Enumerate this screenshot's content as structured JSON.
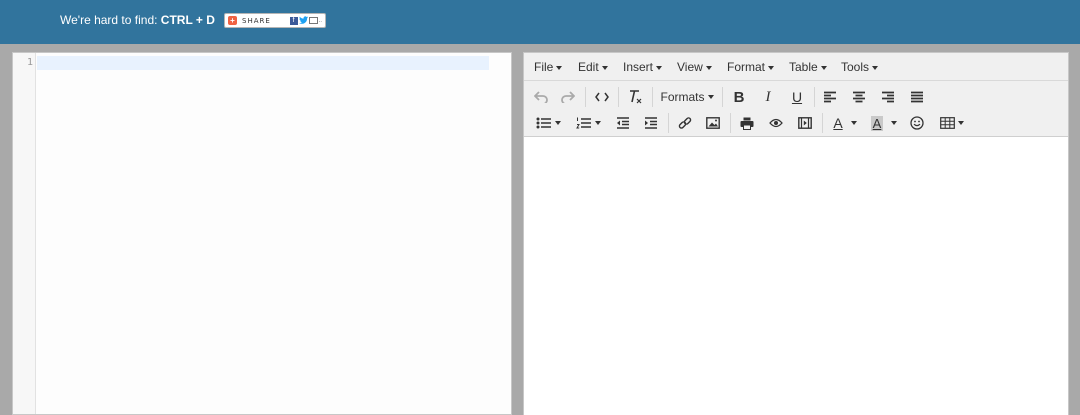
{
  "header": {
    "hint_text": "We're hard to find:",
    "hint_keys": "CTRL + D",
    "share_label": "SHARE",
    "share_plus": "+",
    "share_fb": "f",
    "share_tw": "✓",
    "share_more": ".."
  },
  "code_editor": {
    "line_numbers": [
      "1"
    ],
    "content": ""
  },
  "menubar": {
    "items": [
      "File",
      "Edit",
      "Insert",
      "View",
      "Format",
      "Table",
      "Tools"
    ]
  },
  "toolbar": {
    "formats_label": "Formats",
    "bold_label": "B",
    "italic_label": "I",
    "underline_label": "U",
    "font_color_label": "A",
    "bg_color_label": "A"
  },
  "colors": {
    "header_bg": "#31749d",
    "page_bg": "#a9a9a9",
    "active_line": "#e8f2fe",
    "toolbar_bg": "#f0f0f0"
  }
}
